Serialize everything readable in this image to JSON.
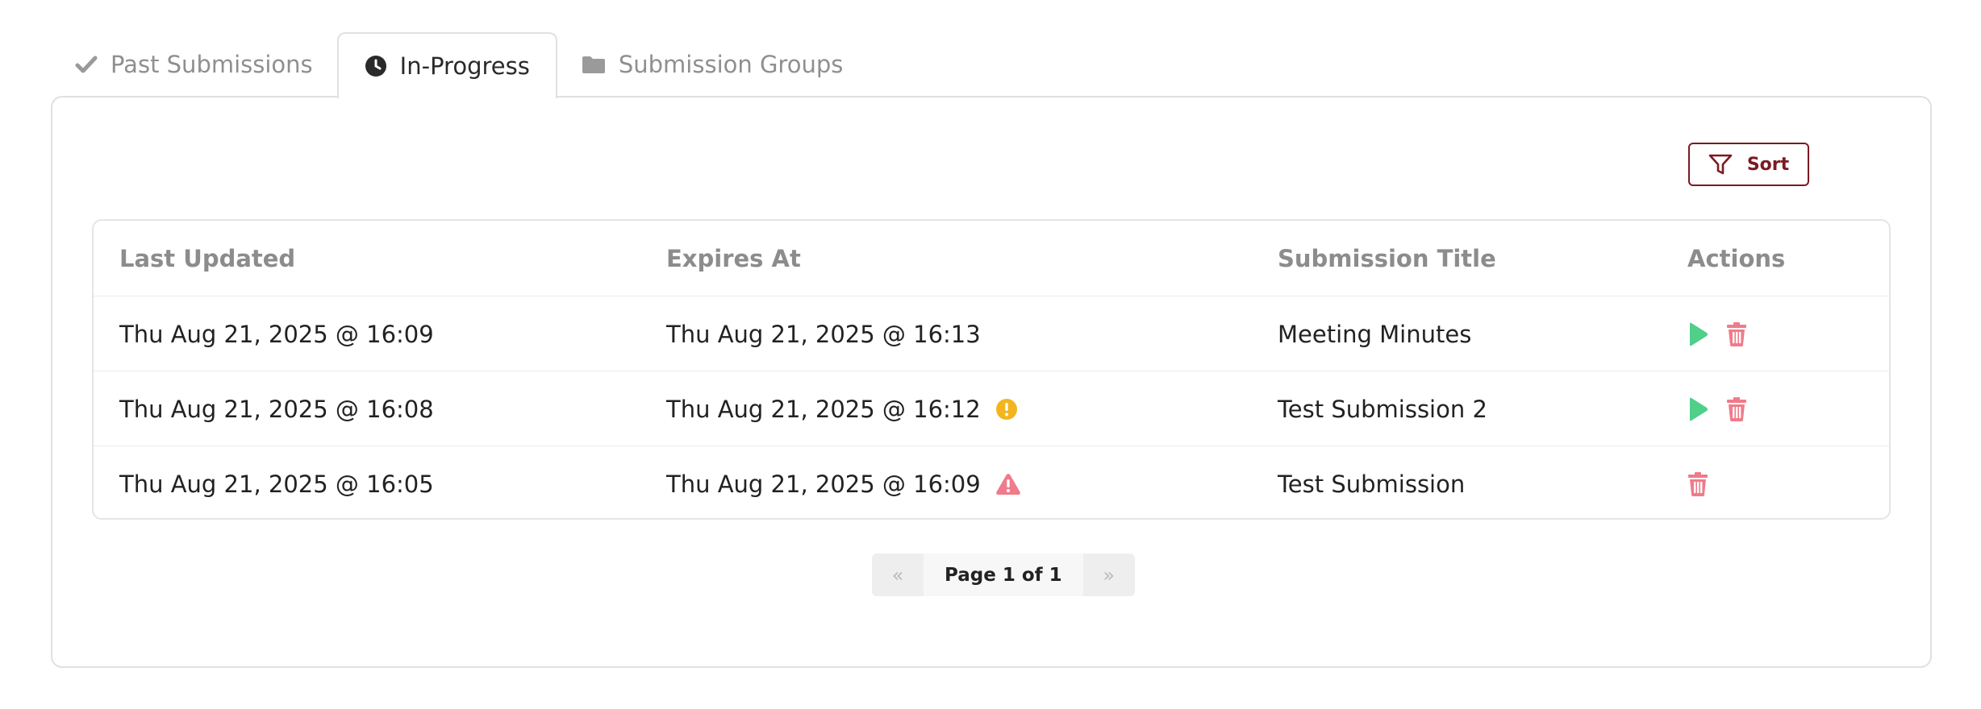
{
  "tabs": [
    {
      "label": "Past Submissions",
      "icon": "check-icon",
      "active": false
    },
    {
      "label": "In-Progress",
      "icon": "clock-icon",
      "active": true
    },
    {
      "label": "Submission Groups",
      "icon": "folder-icon",
      "active": false
    }
  ],
  "toolbar": {
    "sort_label": "Sort",
    "sort_icon": "filter-icon"
  },
  "table": {
    "headers": {
      "last_updated": "Last Updated",
      "expires_at": "Expires At",
      "title": "Submission Title",
      "actions": "Actions"
    },
    "rows": [
      {
        "last_updated": "Thu Aug 21, 2025 @ 16:09",
        "expires_at": "Thu Aug 21, 2025 @ 16:13",
        "title": "Meeting Minutes",
        "status_icon": "",
        "actions": [
          "play-icon",
          "trash-icon"
        ]
      },
      {
        "last_updated": "Thu Aug 21, 2025 @ 16:08",
        "expires_at": "Thu Aug 21, 2025 @ 16:12",
        "title": "Test Submission 2",
        "status_icon": "exclamation-circle-icon",
        "actions": [
          "play-icon",
          "trash-icon"
        ]
      },
      {
        "last_updated": "Thu Aug 21, 2025 @ 16:05",
        "expires_at": "Thu Aug 21, 2025 @ 16:09",
        "title": "Test Submission",
        "status_icon": "warning-triangle-icon",
        "actions": [
          "trash-icon"
        ]
      }
    ]
  },
  "pagination": {
    "prev_label": "«",
    "page_label": "Page 1 of 1",
    "next_label": "»"
  },
  "colors": {
    "accent": "#7a1a22",
    "play": "#4fcf8a",
    "trash": "#f07b8a",
    "warning_yellow": "#f2b51d",
    "danger_red": "#f07b8a",
    "muted_text": "#8f8f8f",
    "border": "#e0e0e0"
  }
}
